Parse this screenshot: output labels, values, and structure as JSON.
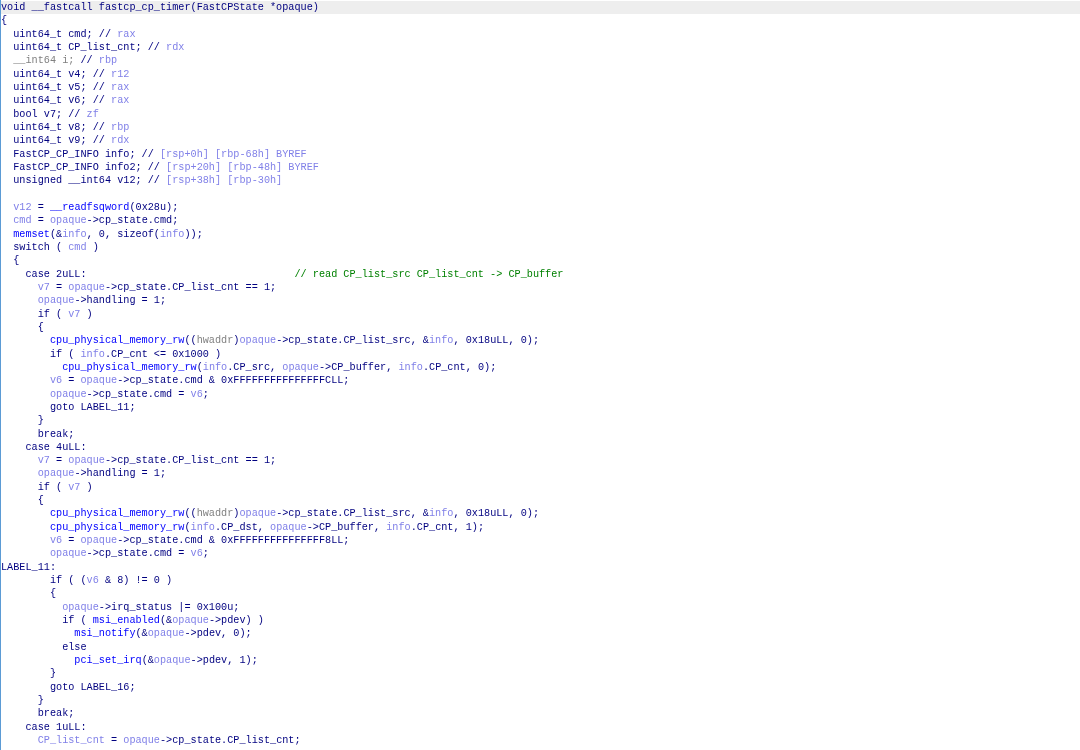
{
  "pseudocode": {
    "lines": [
      {
        "kind": "code",
        "selected": true,
        "tokens": [
          {
            "text": "void __fastcall fastcp_cp_timer(FastCPState *opaque)",
            "kind": "plain"
          }
        ]
      },
      {
        "kind": "code",
        "selected": false,
        "tokens": [
          {
            "text": "{",
            "kind": "plain"
          }
        ]
      },
      {
        "kind": "code",
        "selected": false,
        "tokens": [
          {
            "text": "  uint64_t cmd; // ",
            "kind": "plain"
          },
          {
            "text": "rax",
            "kind": "var"
          }
        ]
      },
      {
        "kind": "code",
        "selected": false,
        "tokens": [
          {
            "text": "  uint64_t CP_list_cnt; // ",
            "kind": "plain"
          },
          {
            "text": "rdx",
            "kind": "var"
          }
        ]
      },
      {
        "kind": "code",
        "selected": false,
        "tokens": [
          {
            "text": "  __int64 i;",
            "kind": "gray"
          },
          {
            "text": " // ",
            "kind": "plain"
          },
          {
            "text": "rbp",
            "kind": "var"
          }
        ]
      },
      {
        "kind": "code",
        "selected": false,
        "tokens": [
          {
            "text": "  uint64_t v4; // ",
            "kind": "plain"
          },
          {
            "text": "r12",
            "kind": "var"
          }
        ]
      },
      {
        "kind": "code",
        "selected": false,
        "tokens": [
          {
            "text": "  uint64_t v5; // ",
            "kind": "plain"
          },
          {
            "text": "rax",
            "kind": "var"
          }
        ]
      },
      {
        "kind": "code",
        "selected": false,
        "tokens": [
          {
            "text": "  uint64_t v6; // ",
            "kind": "plain"
          },
          {
            "text": "rax",
            "kind": "var"
          }
        ]
      },
      {
        "kind": "code",
        "selected": false,
        "tokens": [
          {
            "text": "  bool v7; // ",
            "kind": "plain"
          },
          {
            "text": "zf",
            "kind": "var"
          }
        ]
      },
      {
        "kind": "code",
        "selected": false,
        "tokens": [
          {
            "text": "  uint64_t v8; // ",
            "kind": "plain"
          },
          {
            "text": "rbp",
            "kind": "var"
          }
        ]
      },
      {
        "kind": "code",
        "selected": false,
        "tokens": [
          {
            "text": "  uint64_t v9; // ",
            "kind": "plain"
          },
          {
            "text": "rdx",
            "kind": "var"
          }
        ]
      },
      {
        "kind": "code",
        "selected": false,
        "tokens": [
          {
            "text": "  FastCP_CP_INFO info; // ",
            "kind": "plain"
          },
          {
            "text": "[rsp+0h] [rbp-68h] BYREF",
            "kind": "var"
          }
        ]
      },
      {
        "kind": "code",
        "selected": false,
        "tokens": [
          {
            "text": "  FastCP_CP_INFO info2; // ",
            "kind": "plain"
          },
          {
            "text": "[rsp+20h] [rbp-48h] BYREF",
            "kind": "var"
          }
        ]
      },
      {
        "kind": "code",
        "selected": false,
        "tokens": [
          {
            "text": "  unsigned __int64 v12; // ",
            "kind": "plain"
          },
          {
            "text": "[rsp+38h] [rbp-30h]",
            "kind": "var"
          }
        ]
      },
      {
        "kind": "blank",
        "selected": false
      },
      {
        "kind": "code",
        "selected": false,
        "tokens": [
          {
            "text": "  v12",
            "kind": "var"
          },
          {
            "text": " = ",
            "kind": "plain"
          },
          {
            "text": "__readfsqword",
            "kind": "func"
          },
          {
            "text": "(0x28u);",
            "kind": "plain"
          }
        ]
      },
      {
        "kind": "code",
        "selected": false,
        "tokens": [
          {
            "text": "  cmd",
            "kind": "var"
          },
          {
            "text": " = ",
            "kind": "plain"
          },
          {
            "text": "opaque",
            "kind": "var"
          },
          {
            "text": "->cp_state.cmd;",
            "kind": "plain"
          }
        ]
      },
      {
        "kind": "code",
        "selected": false,
        "tokens": [
          {
            "text": "  memset",
            "kind": "func"
          },
          {
            "text": "(&",
            "kind": "plain"
          },
          {
            "text": "info",
            "kind": "var"
          },
          {
            "text": ", 0, sizeof(",
            "kind": "plain"
          },
          {
            "text": "info",
            "kind": "var"
          },
          {
            "text": "));",
            "kind": "plain"
          }
        ]
      },
      {
        "kind": "code",
        "selected": false,
        "tokens": [
          {
            "text": "  switch ( ",
            "kind": "plain"
          },
          {
            "text": "cmd",
            "kind": "var"
          },
          {
            "text": " )",
            "kind": "plain"
          }
        ]
      },
      {
        "kind": "code",
        "selected": false,
        "tokens": [
          {
            "text": "  {",
            "kind": "plain"
          }
        ]
      },
      {
        "kind": "code",
        "selected": false,
        "tokens": [
          {
            "text": "    case 2uLL:                                  ",
            "kind": "plain"
          },
          {
            "text": "// read CP_list_src CP_list_cnt -> CP_buffer",
            "kind": "comment"
          }
        ]
      },
      {
        "kind": "code",
        "selected": false,
        "tokens": [
          {
            "text": "      v7",
            "kind": "var"
          },
          {
            "text": " = ",
            "kind": "plain"
          },
          {
            "text": "opaque",
            "kind": "var"
          },
          {
            "text": "->cp_state.CP_list_cnt == 1;",
            "kind": "plain"
          }
        ]
      },
      {
        "kind": "code",
        "selected": false,
        "tokens": [
          {
            "text": "      opaque",
            "kind": "var"
          },
          {
            "text": "->handling = 1;",
            "kind": "plain"
          }
        ]
      },
      {
        "kind": "code",
        "selected": false,
        "tokens": [
          {
            "text": "      if ( ",
            "kind": "plain"
          },
          {
            "text": "v7",
            "kind": "var"
          },
          {
            "text": " )",
            "kind": "plain"
          }
        ]
      },
      {
        "kind": "code",
        "selected": false,
        "tokens": [
          {
            "text": "      {",
            "kind": "plain"
          }
        ]
      },
      {
        "kind": "code",
        "selected": false,
        "tokens": [
          {
            "text": "        cpu_physical_memory_rw",
            "kind": "func"
          },
          {
            "text": "((",
            "kind": "plain"
          },
          {
            "text": "hwaddr",
            "kind": "gray"
          },
          {
            "text": ")",
            "kind": "plain"
          },
          {
            "text": "opaque",
            "kind": "var"
          },
          {
            "text": "->cp_state.CP_list_src, &",
            "kind": "plain"
          },
          {
            "text": "info",
            "kind": "var"
          },
          {
            "text": ", 0x18uLL, 0);",
            "kind": "plain"
          }
        ]
      },
      {
        "kind": "code",
        "selected": false,
        "tokens": [
          {
            "text": "        if ( ",
            "kind": "plain"
          },
          {
            "text": "info",
            "kind": "var"
          },
          {
            "text": ".CP_cnt <= 0x1000 )",
            "kind": "plain"
          }
        ]
      },
      {
        "kind": "code",
        "selected": false,
        "tokens": [
          {
            "text": "          cpu_physical_memory_rw",
            "kind": "func"
          },
          {
            "text": "(",
            "kind": "plain"
          },
          {
            "text": "info",
            "kind": "var"
          },
          {
            "text": ".CP_src, ",
            "kind": "plain"
          },
          {
            "text": "opaque",
            "kind": "var"
          },
          {
            "text": "->CP_buffer, ",
            "kind": "plain"
          },
          {
            "text": "info",
            "kind": "var"
          },
          {
            "text": ".CP_cnt, 0);",
            "kind": "plain"
          }
        ]
      },
      {
        "kind": "code",
        "selected": false,
        "tokens": [
          {
            "text": "        v6",
            "kind": "var"
          },
          {
            "text": " = ",
            "kind": "plain"
          },
          {
            "text": "opaque",
            "kind": "var"
          },
          {
            "text": "->cp_state.cmd & 0xFFFFFFFFFFFFFFFCLL;",
            "kind": "plain"
          }
        ]
      },
      {
        "kind": "code",
        "selected": false,
        "tokens": [
          {
            "text": "        opaque",
            "kind": "var"
          },
          {
            "text": "->cp_state.cmd = ",
            "kind": "plain"
          },
          {
            "text": "v6",
            "kind": "var"
          },
          {
            "text": ";",
            "kind": "plain"
          }
        ]
      },
      {
        "kind": "code",
        "selected": false,
        "tokens": [
          {
            "text": "        goto LABEL_11;",
            "kind": "plain"
          }
        ]
      },
      {
        "kind": "code",
        "selected": false,
        "tokens": [
          {
            "text": "      }",
            "kind": "plain"
          }
        ]
      },
      {
        "kind": "code",
        "selected": false,
        "tokens": [
          {
            "text": "      break;",
            "kind": "plain"
          }
        ]
      },
      {
        "kind": "code",
        "selected": false,
        "tokens": [
          {
            "text": "    case 4uLL:",
            "kind": "plain"
          }
        ]
      },
      {
        "kind": "code",
        "selected": false,
        "tokens": [
          {
            "text": "      v7",
            "kind": "var"
          },
          {
            "text": " = ",
            "kind": "plain"
          },
          {
            "text": "opaque",
            "kind": "var"
          },
          {
            "text": "->cp_state.CP_list_cnt == 1;",
            "kind": "plain"
          }
        ]
      },
      {
        "kind": "code",
        "selected": false,
        "tokens": [
          {
            "text": "      opaque",
            "kind": "var"
          },
          {
            "text": "->handling = 1;",
            "kind": "plain"
          }
        ]
      },
      {
        "kind": "code",
        "selected": false,
        "tokens": [
          {
            "text": "      if ( ",
            "kind": "plain"
          },
          {
            "text": "v7",
            "kind": "var"
          },
          {
            "text": " )",
            "kind": "plain"
          }
        ]
      },
      {
        "kind": "code",
        "selected": false,
        "tokens": [
          {
            "text": "      {",
            "kind": "plain"
          }
        ]
      },
      {
        "kind": "code",
        "selected": false,
        "tokens": [
          {
            "text": "        cpu_physical_memory_rw",
            "kind": "func"
          },
          {
            "text": "((",
            "kind": "plain"
          },
          {
            "text": "hwaddr",
            "kind": "gray"
          },
          {
            "text": ")",
            "kind": "plain"
          },
          {
            "text": "opaque",
            "kind": "var"
          },
          {
            "text": "->cp_state.CP_list_src, &",
            "kind": "plain"
          },
          {
            "text": "info",
            "kind": "var"
          },
          {
            "text": ", 0x18uLL, 0);",
            "kind": "plain"
          }
        ]
      },
      {
        "kind": "code",
        "selected": false,
        "tokens": [
          {
            "text": "        cpu_physical_memory_rw",
            "kind": "func"
          },
          {
            "text": "(",
            "kind": "plain"
          },
          {
            "text": "info",
            "kind": "var"
          },
          {
            "text": ".CP_dst, ",
            "kind": "plain"
          },
          {
            "text": "opaque",
            "kind": "var"
          },
          {
            "text": "->CP_buffer, ",
            "kind": "plain"
          },
          {
            "text": "info",
            "kind": "var"
          },
          {
            "text": ".CP_cnt, 1);",
            "kind": "plain"
          }
        ]
      },
      {
        "kind": "code",
        "selected": false,
        "tokens": [
          {
            "text": "        v6",
            "kind": "var"
          },
          {
            "text": " = ",
            "kind": "plain"
          },
          {
            "text": "opaque",
            "kind": "var"
          },
          {
            "text": "->cp_state.cmd & 0xFFFFFFFFFFFFFFF8LL;",
            "kind": "plain"
          }
        ]
      },
      {
        "kind": "code",
        "selected": false,
        "tokens": [
          {
            "text": "        opaque",
            "kind": "var"
          },
          {
            "text": "->cp_state.cmd = ",
            "kind": "plain"
          },
          {
            "text": "v6",
            "kind": "var"
          },
          {
            "text": ";",
            "kind": "plain"
          }
        ]
      },
      {
        "kind": "code",
        "selected": false,
        "tokens": [
          {
            "text": "LABEL_11:",
            "kind": "plain"
          }
        ]
      },
      {
        "kind": "code",
        "selected": false,
        "tokens": [
          {
            "text": "        if ( (",
            "kind": "plain"
          },
          {
            "text": "v6",
            "kind": "var"
          },
          {
            "text": " & 8) != 0 )",
            "kind": "plain"
          }
        ]
      },
      {
        "kind": "code",
        "selected": false,
        "tokens": [
          {
            "text": "        {",
            "kind": "plain"
          }
        ]
      },
      {
        "kind": "code",
        "selected": false,
        "tokens": [
          {
            "text": "          opaque",
            "kind": "var"
          },
          {
            "text": "->irq_status |= 0x100u;",
            "kind": "plain"
          }
        ]
      },
      {
        "kind": "code",
        "selected": false,
        "tokens": [
          {
            "text": "          if ( ",
            "kind": "plain"
          },
          {
            "text": "msi_enabled",
            "kind": "func"
          },
          {
            "text": "(&",
            "kind": "plain"
          },
          {
            "text": "opaque",
            "kind": "var"
          },
          {
            "text": "->pdev) )",
            "kind": "plain"
          }
        ]
      },
      {
        "kind": "code",
        "selected": false,
        "tokens": [
          {
            "text": "            msi_notify",
            "kind": "func"
          },
          {
            "text": "(&",
            "kind": "plain"
          },
          {
            "text": "opaque",
            "kind": "var"
          },
          {
            "text": "->pdev, 0);",
            "kind": "plain"
          }
        ]
      },
      {
        "kind": "code",
        "selected": false,
        "tokens": [
          {
            "text": "          else",
            "kind": "plain"
          }
        ]
      },
      {
        "kind": "code",
        "selected": false,
        "tokens": [
          {
            "text": "            pci_set_irq",
            "kind": "func"
          },
          {
            "text": "(&",
            "kind": "plain"
          },
          {
            "text": "opaque",
            "kind": "var"
          },
          {
            "text": "->pdev, 1);",
            "kind": "plain"
          }
        ]
      },
      {
        "kind": "code",
        "selected": false,
        "tokens": [
          {
            "text": "        }",
            "kind": "plain"
          }
        ]
      },
      {
        "kind": "code",
        "selected": false,
        "tokens": [
          {
            "text": "        goto LABEL_16;",
            "kind": "plain"
          }
        ]
      },
      {
        "kind": "code",
        "selected": false,
        "tokens": [
          {
            "text": "      }",
            "kind": "plain"
          }
        ]
      },
      {
        "kind": "code",
        "selected": false,
        "tokens": [
          {
            "text": "      break;",
            "kind": "plain"
          }
        ]
      },
      {
        "kind": "code",
        "selected": false,
        "tokens": [
          {
            "text": "    case 1uLL:",
            "kind": "plain"
          }
        ]
      },
      {
        "kind": "code",
        "selected": false,
        "tokens": [
          {
            "text": "      CP_list_cnt",
            "kind": "var"
          },
          {
            "text": " = ",
            "kind": "plain"
          },
          {
            "text": "opaque",
            "kind": "var"
          },
          {
            "text": "->cp_state.CP_list_cnt;",
            "kind": "plain"
          }
        ]
      }
    ]
  }
}
